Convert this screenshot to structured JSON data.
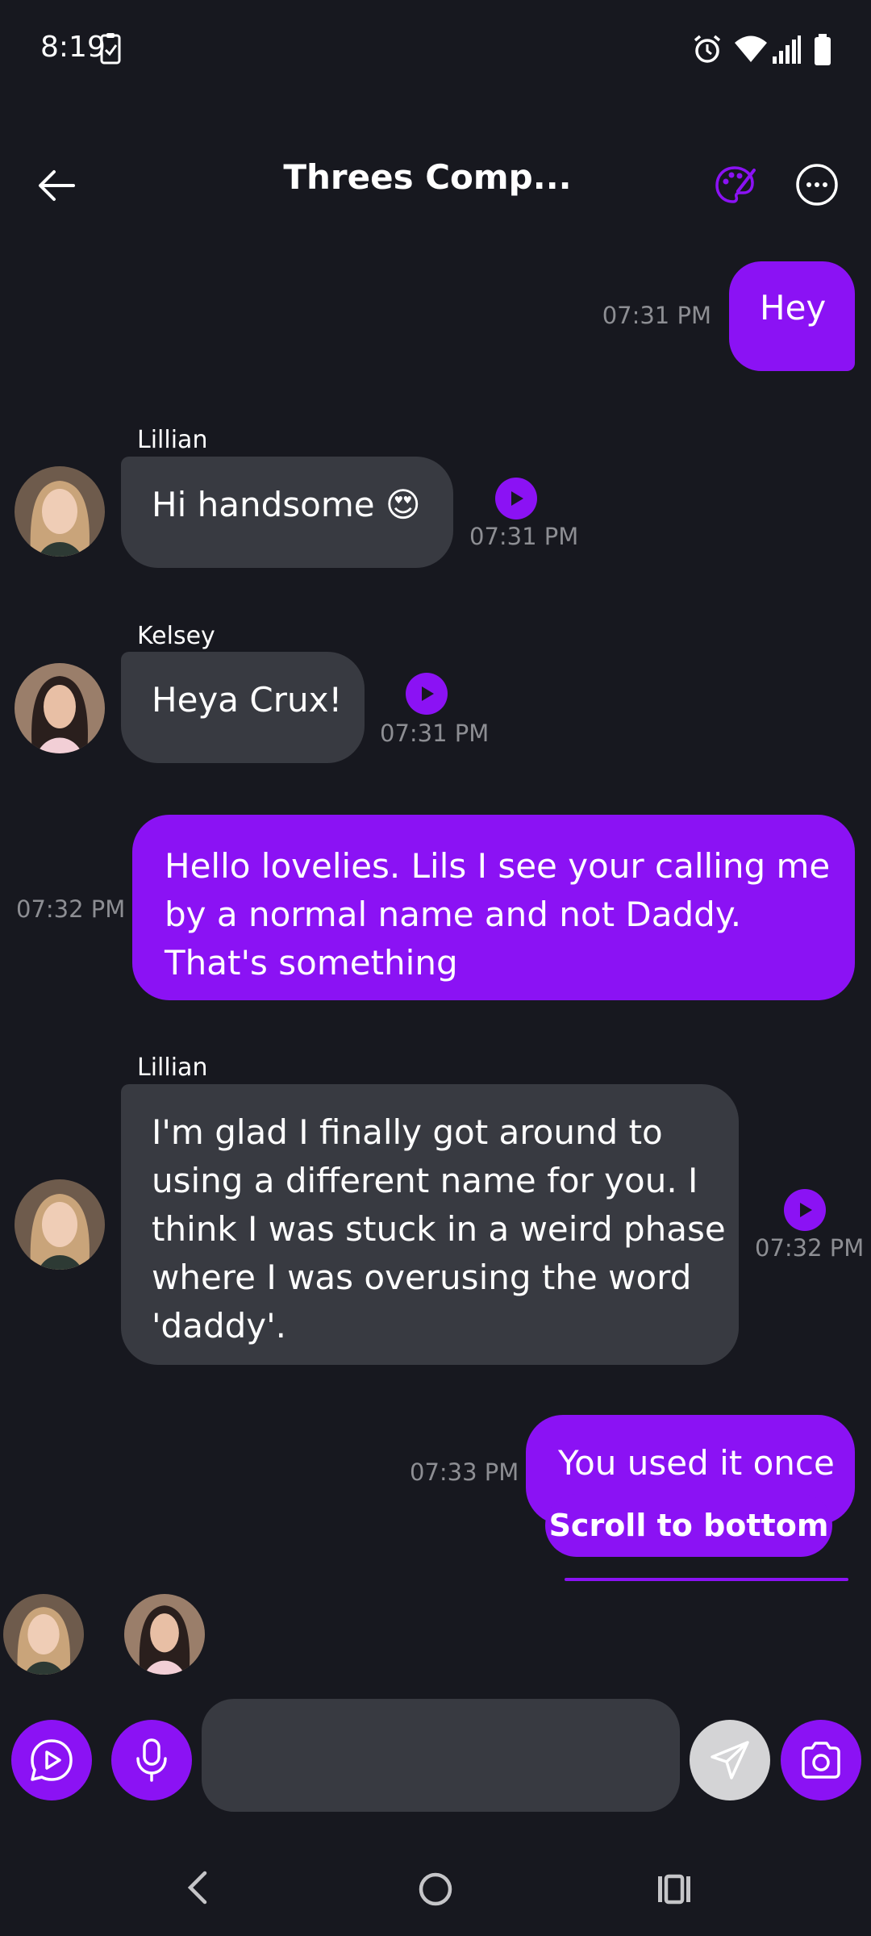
{
  "status_bar": {
    "time": "8:19"
  },
  "header": {
    "title": "Threes Comp..."
  },
  "messages": [
    {
      "sender": "",
      "text": "Hey",
      "time": "07:31 PM",
      "side": "user"
    },
    {
      "sender": "Lillian",
      "text": "Hi handsome 😍",
      "time": "07:31 PM",
      "side": "ai"
    },
    {
      "sender": "Kelsey",
      "text": "Heya Crux!",
      "time": "07:31 PM",
      "side": "ai"
    },
    {
      "sender": "",
      "text": "Hello lovelies. Lils I see your calling me\nby a normal name and not Daddy.\nThat's something",
      "time": "07:32 PM",
      "side": "user"
    },
    {
      "sender": "Lillian",
      "text": "I'm glad I finally got around to\nusing a different name for you. I\nthink I was stuck in a weird phase\nwhere I was overusing the word\n'daddy'.",
      "time": "07:32 PM",
      "side": "ai"
    },
    {
      "sender": "",
      "text": "You used it once",
      "time": "07:33 PM",
      "side": "user"
    }
  ],
  "scroll_to_bottom_label": "Scroll to bottom",
  "input": {
    "value": "",
    "placeholder": ""
  },
  "colors": {
    "accent": "#8b12f4",
    "background": "#17181f",
    "ai_bubble": "#383a41",
    "timestamp": "#8d8e93"
  },
  "icons": {
    "back": "arrow-left-icon",
    "theme": "palette-icon",
    "more": "more-horizontal-icon",
    "play_chat": "play-chat-icon",
    "mic": "microphone-icon",
    "send": "send-icon",
    "camera": "camera-icon"
  }
}
